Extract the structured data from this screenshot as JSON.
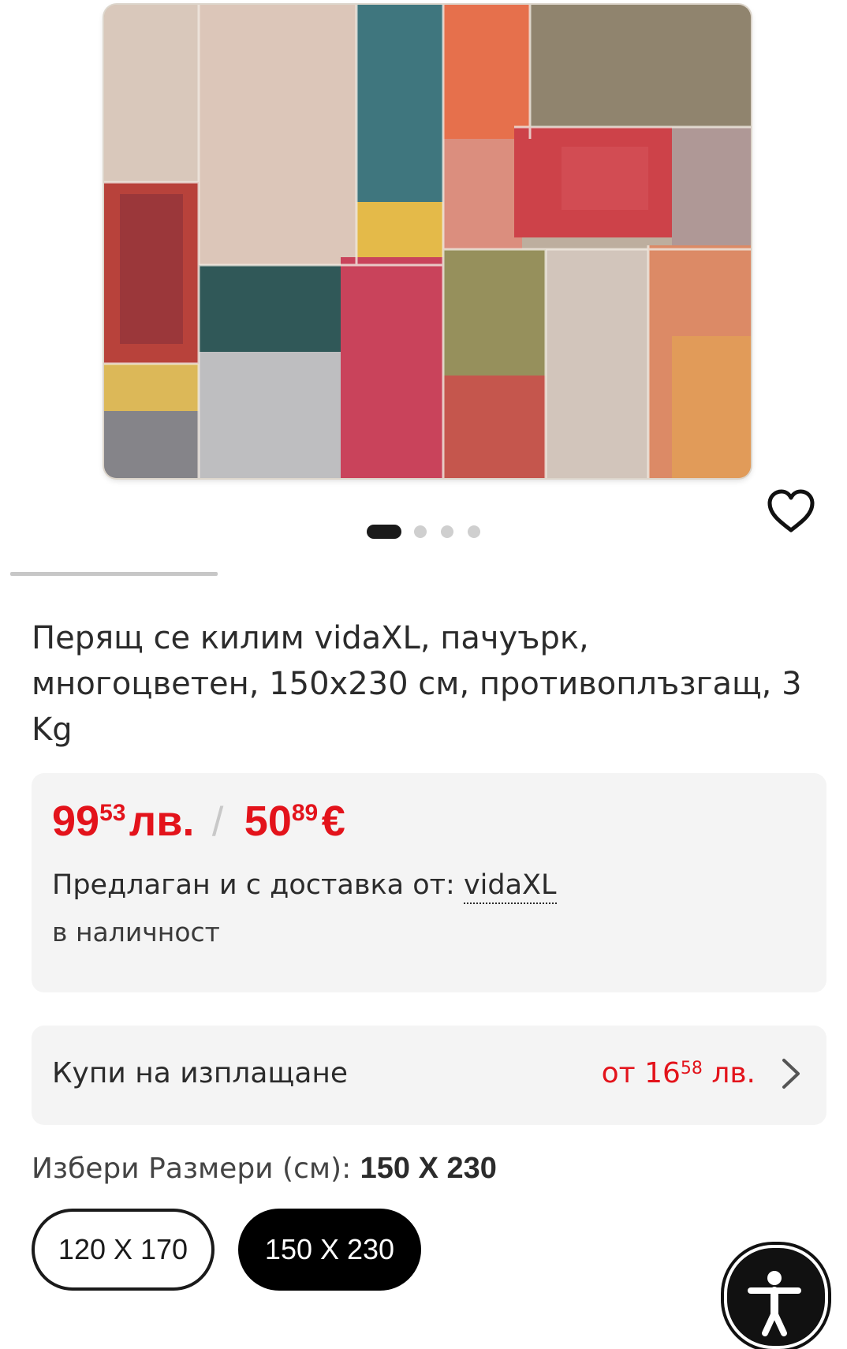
{
  "product": {
    "title": "Перящ се килим vidaXL, пачуърк, многоцветен, 150x230 см, противоплъзгащ, 3 Kg",
    "image_alt": "Многоцветен пачуърк килим"
  },
  "gallery": {
    "total_images": 4,
    "active_index": 0
  },
  "price": {
    "bgn_whole": "99",
    "bgn_cents": "53",
    "bgn_currency": "лв.",
    "separator": "/",
    "eur_whole": "50",
    "eur_cents": "89",
    "eur_currency": "€"
  },
  "seller": {
    "prefix": "Предлаган и с доставка от:",
    "name": "vidaXL",
    "availability": "в наличност"
  },
  "installment": {
    "label": "Купи на изплащане",
    "prefix": "от",
    "whole": "16",
    "cents": "58",
    "currency": "лв."
  },
  "size": {
    "label": "Избери Размери (см):",
    "selected": "150 X 230",
    "options": [
      "120 X 170",
      "150 X 230"
    ]
  },
  "colors": {
    "accent_red": "#e3131b",
    "box_bg": "#f4f4f4",
    "selected_bg": "#000000"
  },
  "icons": [
    "heart-icon",
    "chevron-right-icon",
    "accessibility-icon"
  ]
}
